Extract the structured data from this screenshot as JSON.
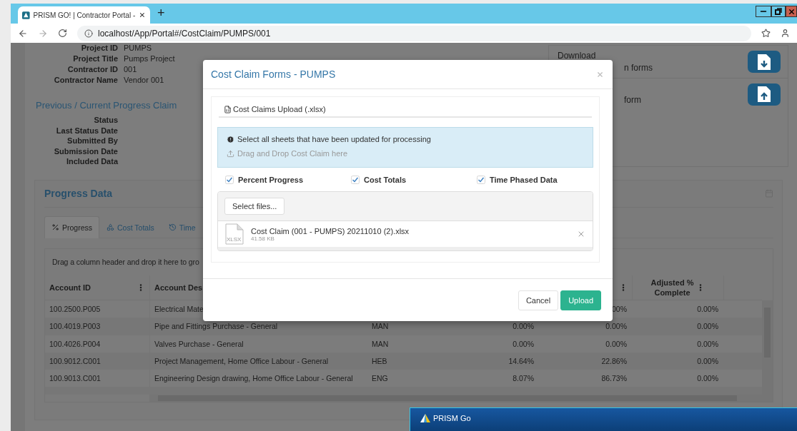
{
  "browser": {
    "tab_title": "PRISM GO! | Contractor Portal -",
    "new_tab": "+",
    "url": "localhost/App/Portal#/CostClaim/PUMPS/001"
  },
  "project_info": [
    {
      "label": "Project ID",
      "value": "PUMPS"
    },
    {
      "label": "Project Title",
      "value": "Pumps Project"
    },
    {
      "label": "Contractor ID",
      "value": "001"
    },
    {
      "label": "Contractor Name",
      "value": "Vendor 001"
    }
  ],
  "claim": {
    "title": "Previous / Current Progress Claim",
    "fields": [
      "Status",
      "Last Status Date",
      "Submitted By",
      "Submission Date",
      "Included Data"
    ]
  },
  "forms_panel": [
    {
      "kind": "download",
      "heading": "Download",
      "caption": "n forms"
    },
    {
      "kind": "upload",
      "caption": "form"
    }
  ],
  "progress": {
    "title": "Progress Data",
    "tabs": [
      {
        "kind": "percent",
        "label": "Progress",
        "selected": true
      },
      {
        "kind": "totals",
        "label": "Cost Totals",
        "selected": false
      },
      {
        "kind": "time",
        "label": "Time",
        "selected": false
      }
    ],
    "group_hint": "Drag a column header and drop it here to gro",
    "columns": [
      {
        "label": "Account ID",
        "menu": true
      },
      {
        "label": "Account Des",
        "menu": false
      },
      null,
      null,
      {
        "menu": true
      },
      {
        "label": "Adjusted % Complete",
        "menu": true
      }
    ],
    "rows": [
      [
        "100.2500.P005",
        "Electrical Mate",
        null,
        null,
        "00%",
        "0.00%"
      ],
      [
        "100.4019.P003",
        "Pipe and Fittings Purchase - General",
        "MAN",
        "0.00%",
        "0.00%",
        "0.00%"
      ],
      [
        "100.4026.P004",
        "Valves Purchase - General",
        "MAN",
        "0.00%",
        "0.00%",
        "0.00%"
      ],
      [
        "100.9012.C001",
        "Project Management, Home Office Labour - General",
        "HEB",
        "14.64%",
        "22.86%",
        "0.00%"
      ],
      [
        "100.9013.C001",
        "Engineering Design drawing, Home Office Labour - General",
        "ENG",
        "8.07%",
        "86.73%",
        "0.00%"
      ]
    ]
  },
  "modal": {
    "title": "Cost Claim Forms - PUMPS",
    "section": "Cost Claims Upload (.xlsx)",
    "info": "Select all sheets that have been updated for processing",
    "drop_hint": "Drag and Drop Cost Claim here",
    "sheets": [
      {
        "label": "Percent Progress",
        "checked": true
      },
      {
        "label": "Cost Totals",
        "checked": true
      },
      {
        "label": "Time Phased Data",
        "checked": true
      }
    ],
    "select_button": "Select files...",
    "files": [
      {
        "name": "Cost Claim (001 - PUMPS) 20211010 (2).xlsx",
        "size": "41.58 KB",
        "type_label": "XLSX"
      }
    ],
    "buttons": [
      {
        "label": "Cancel",
        "kind": "secondary"
      },
      {
        "label": "Upload",
        "kind": "primary"
      }
    ]
  },
  "taskbar_window": {
    "title": "PRISM Go"
  }
}
